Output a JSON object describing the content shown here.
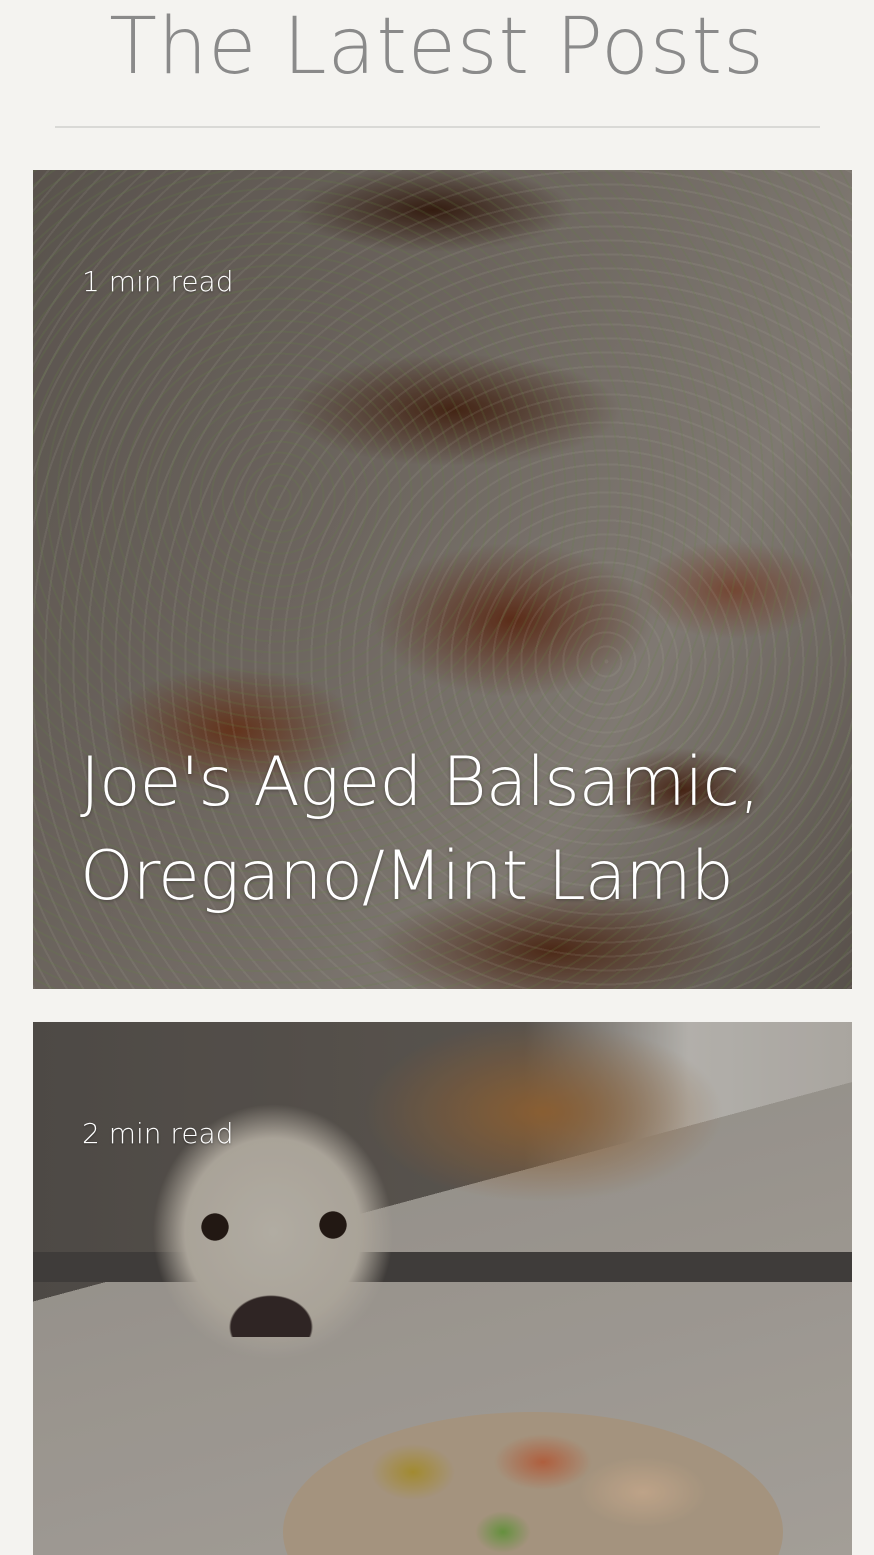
{
  "section": {
    "title": "The Latest Posts"
  },
  "posts": [
    {
      "read_time": "1 min read",
      "title": "Joe's Aged Balsamic, Oregano/Mint Lamb",
      "cover_image": "grilled-lamb-chops-photo"
    },
    {
      "read_time": "2 min read",
      "title": "",
      "cover_image": "dog-and-soup-photo"
    }
  ]
}
